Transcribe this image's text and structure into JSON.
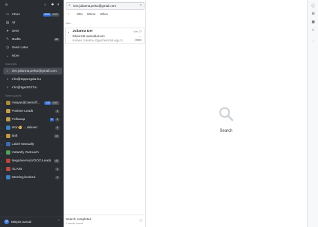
{
  "sidebar": {
    "top_icons": [
      "sidebar-toggle-icon",
      "pin-icon",
      "compose-icon",
      "chevron-down-icon"
    ],
    "items": [
      {
        "label": "Inbox",
        "icon": "inbox-icon",
        "badge1": "3000",
        "badge2": "8407"
      },
      {
        "label": "All",
        "icon": "all-mail-icon"
      },
      {
        "label": "Sent",
        "icon": "sent-icon"
      },
      {
        "label": "Drafts",
        "icon": "drafts-icon",
        "badge2": "85"
      },
      {
        "label": "Send Later",
        "icon": "clock-icon"
      },
      {
        "label": "More",
        "icon": "chevron-down-icon"
      }
    ],
    "searches_heading": "Searches",
    "searches": [
      {
        "label": "izer.julianna.pelso@gmail.com"
      },
      {
        "label": "info@toppergola.hu"
      },
      {
        "label": "info@tiger507.hu"
      }
    ],
    "team_heading": "Team spaces",
    "teams": [
      {
        "label": "matyas@clientoff...",
        "badge1": "140",
        "badge2": "3467",
        "color": "#b38b3a"
      },
      {
        "label": "Positive Leads",
        "badge2": "5",
        "color": "#c7a14a"
      },
      {
        "label": "Followup",
        "badge1": "1",
        "badge2": "6",
        "color": "#c3a04a"
      },
      {
        "label": "Won🥳→ deliver!",
        "badge2": "8",
        "color": "#3b86c6"
      },
      {
        "label": "Bolt",
        "badge2": "14",
        "color": "#c69b3b"
      },
      {
        "label": "Label Manually",
        "color": "#3a6fb8"
      },
      {
        "label": "Instantly Outreach",
        "color": "#4ea85b"
      },
      {
        "label": "Negative/Auto/OOO Leads",
        "badge2": "46",
        "color": "#c0443a"
      },
      {
        "label": "GLABs",
        "badge2": "2",
        "color": "#c04a3f"
      },
      {
        "label": "Meeting booked",
        "badge2": "1",
        "color": "#3b86c6"
      }
    ],
    "user": {
      "initial": "M",
      "name": "Mátyás Sarudi"
    }
  },
  "search": {
    "query": "izer.julianna.pelso@gmail.com",
    "filters": [
      "Who",
      "Where",
      "When"
    ]
  },
  "results": {
    "group": "Misc",
    "messages": [
      {
        "from": "Julianna Izer",
        "date": "Mar 27",
        "subject": "Elkészült weboldal terv",
        "preview": "Kedves Julianna, Egyeztessünk egy rö...",
        "tag": "Inbox"
      }
    ],
    "status": "Search completed",
    "count": "1 results found"
  },
  "content": {
    "label": "Search"
  },
  "rail": {
    "icons": [
      "info-icon",
      "grid-icon",
      "calendar-icon",
      "plus-icon",
      "more-icon"
    ]
  },
  "colors": {
    "sidebar_bg": "#2a2d31",
    "accent": "#2f6fd6"
  }
}
